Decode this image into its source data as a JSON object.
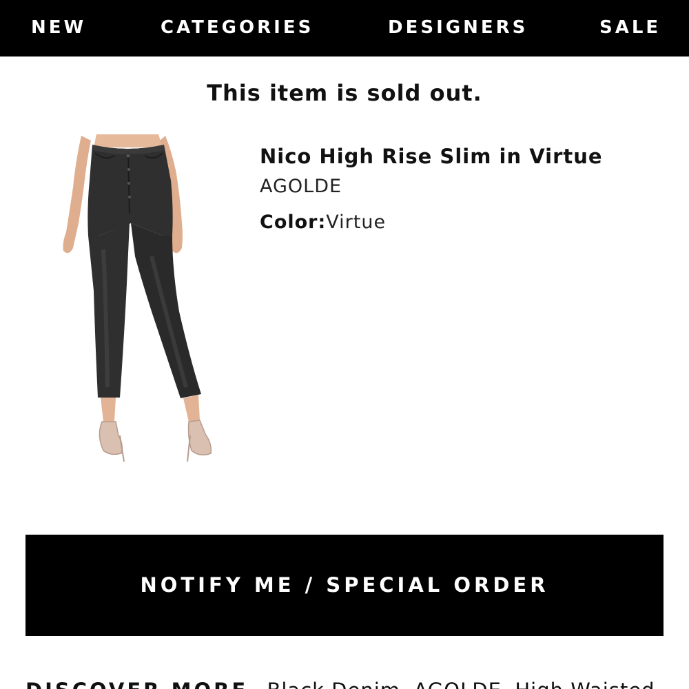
{
  "nav": {
    "items": [
      {
        "label": "NEW"
      },
      {
        "label": "CATEGORIES"
      },
      {
        "label": "DESIGNERS"
      },
      {
        "label": "SALE"
      }
    ]
  },
  "status": {
    "message": "This item is sold out."
  },
  "product": {
    "name": "Nico High Rise Slim in Virtue",
    "brand": "AGOLDE",
    "color_label": "Color:",
    "color_value": "Virtue",
    "image_alt": "Nico High Rise Slim in Virtue"
  },
  "actions": {
    "notify_label": "NOTIFY ME / SPECIAL ORDER"
  },
  "discover": {
    "label": "DISCOVER MORE",
    "links": [
      "Black Denim,",
      "AGOLDE,",
      "High Waisted"
    ]
  },
  "colors": {
    "nav_bg": "#000000",
    "button_bg": "#000000",
    "text": "#111111",
    "jeans": "#2f2f2f",
    "skin": "#e6b99a"
  }
}
